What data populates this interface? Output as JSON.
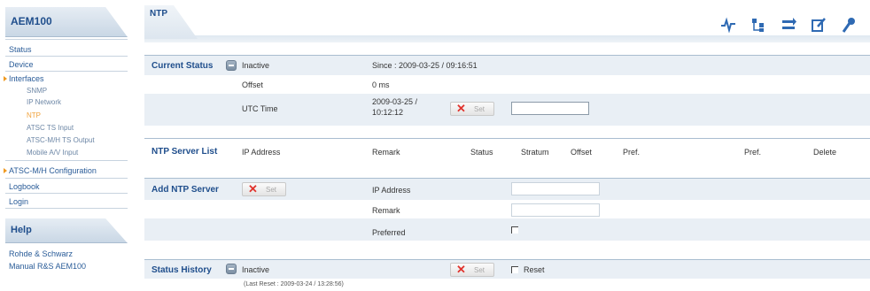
{
  "sidebar": {
    "title": "AEM100",
    "items": [
      {
        "label": "Status"
      },
      {
        "label": "Device"
      },
      {
        "label": "Interfaces"
      },
      {
        "label": "ATSC-M/H Configuration"
      },
      {
        "label": "Logbook"
      },
      {
        "label": "Login"
      }
    ],
    "subitems": [
      {
        "label": "SNMP"
      },
      {
        "label": "IP Network"
      },
      {
        "label": "NTP"
      },
      {
        "label": "ATSC TS Input"
      },
      {
        "label": "ATSC-M/H TS Output"
      },
      {
        "label": "Mobile A/V Input"
      }
    ],
    "help_title": "Help",
    "help_links": [
      {
        "label": "Rohde & Schwarz"
      },
      {
        "label": "Manual R&S AEM100"
      }
    ]
  },
  "header": {
    "tab_label": "NTP",
    "tool_icons": [
      "signal-icon",
      "tree-icon",
      "transfer-icon",
      "edit-icon",
      "settings-icon"
    ]
  },
  "current_status": {
    "label": "Current Status",
    "state": "Inactive",
    "since": "Since : 2009-03-25 / 09:16:51",
    "offset_label": "Offset",
    "offset_value": "0 ms",
    "utc_label": "UTC Time",
    "utc_value_line1": "2009-03-25 /",
    "utc_value_line2": "10:12:12",
    "set_label": "Set",
    "utc_input_value": ""
  },
  "server_list": {
    "label": "NTP Server List",
    "columns": [
      "IP Address",
      "Remark",
      "Status",
      "Stratum",
      "Offset",
      "Pref.",
      "Pref.",
      "Delete"
    ]
  },
  "add_server": {
    "label": "Add NTP Server",
    "set_label": "Set",
    "ip_label": "IP Address",
    "ip_value": "",
    "remark_label": "Remark",
    "remark_value": "",
    "preferred_label": "Preferred",
    "preferred_checked": false
  },
  "status_history": {
    "label": "Status History",
    "state": "Inactive",
    "last_reset": "(Last Reset : 2009-03-24 / 13:28:56)",
    "set_label": "Set",
    "reset_label": "Reset",
    "reset_checked": false
  },
  "colors": {
    "accent": "#1f4e8c",
    "band": "#e9eff5",
    "active_nav": "#f1a23b",
    "set_x": "#e0332d"
  }
}
